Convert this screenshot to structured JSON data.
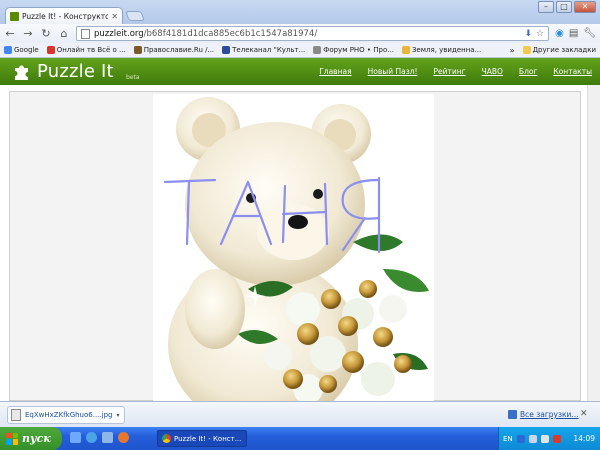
{
  "browser": {
    "tab_title": "Puzzle It! - Конструктор п",
    "url_domain": "puzzleit.org",
    "url_path": "/b68f4181d1dca885ec6b1c1547a81974/"
  },
  "bookmarks": [
    {
      "label": "Google",
      "color": "#4285f4"
    },
    {
      "label": "Онлайн тв Всё о ...",
      "color": "#d9342b"
    },
    {
      "label": "Православие.Ru /...",
      "color": "#7a5a2a"
    },
    {
      "label": "Телеканал \"Культ...",
      "color": "#2b4c9b"
    },
    {
      "label": "Форум РНО • Про...",
      "color": "#8a8a8a"
    },
    {
      "label": "Земля, увиденна...",
      "color": "#e8b43a"
    }
  ],
  "bookmarks_more": "»",
  "other_bookmarks": "Другие закладки",
  "site": {
    "logo": "Puzzle It",
    "beta": "beta",
    "nav": [
      "Главная",
      "Новый Пазл!",
      "Рейтинг",
      "ЧАВО",
      "Блог",
      "Контакты"
    ]
  },
  "picture": {
    "drawn_text": "ТАНЯ",
    "ink_color": "#8b8ff0"
  },
  "downloads": {
    "file_name": "EqXwHxZKfkGhuo6....jpg",
    "all_downloads": "Все загрузки..."
  },
  "taskbar": {
    "start": "пуск",
    "task_label": "Puzzle It! - Конст...",
    "lang": "EN",
    "clock": "14:09"
  }
}
